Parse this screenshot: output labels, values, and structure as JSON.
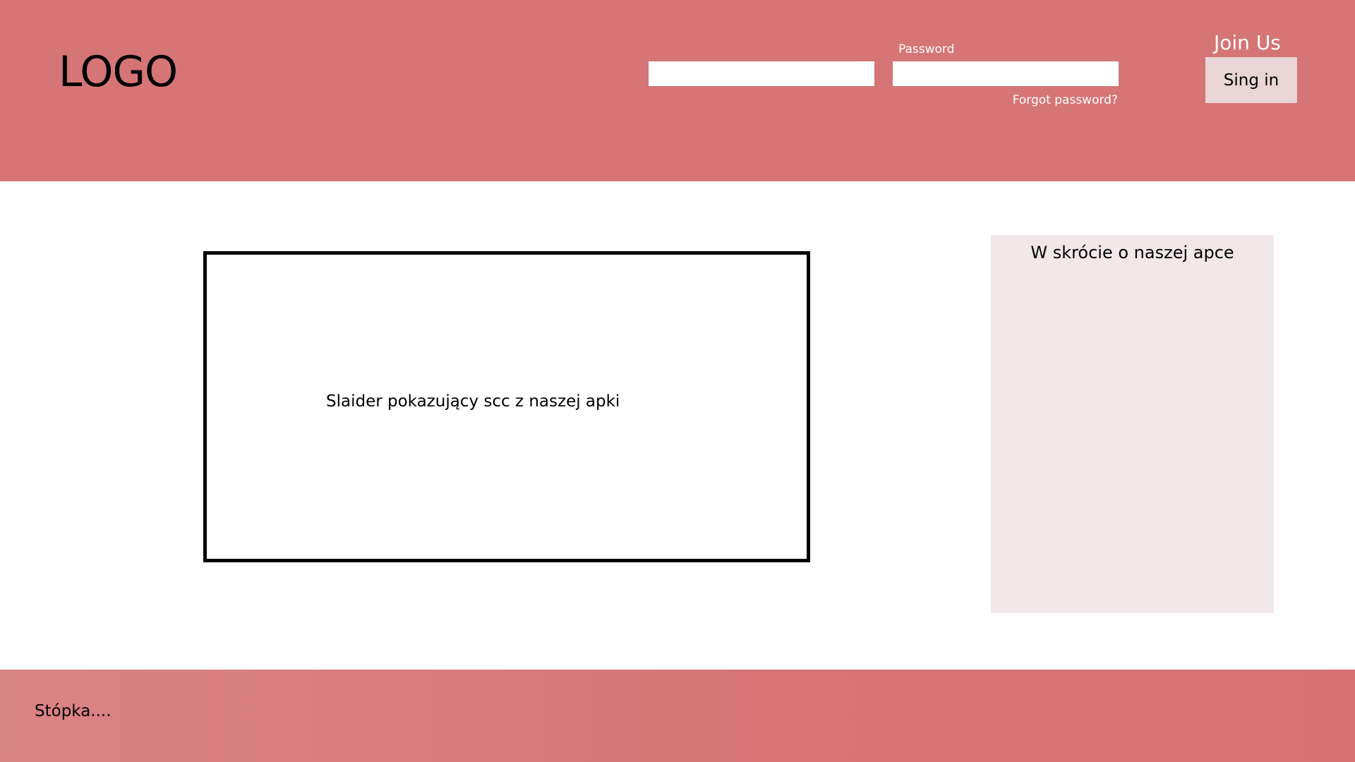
{
  "colors": {
    "header_bg": "#d57575",
    "footer_bg": "#d57172",
    "signin_button_bg": "#ead5d6",
    "about_panel_bg": "#f2e8e9",
    "slider_border": "#000000"
  },
  "header": {
    "logo": "LOGO",
    "login": {
      "username_value": "",
      "password_label": "Password",
      "password_value": "",
      "forgot_password": "Forgot password?"
    },
    "join_us": "Join Us",
    "signin_label": "Sing in"
  },
  "main": {
    "slider_text": "Slaider pokazujący scc z naszej apki",
    "about_title": "W skrócie o naszej apce"
  },
  "footer": {
    "text": "Stópka...."
  }
}
